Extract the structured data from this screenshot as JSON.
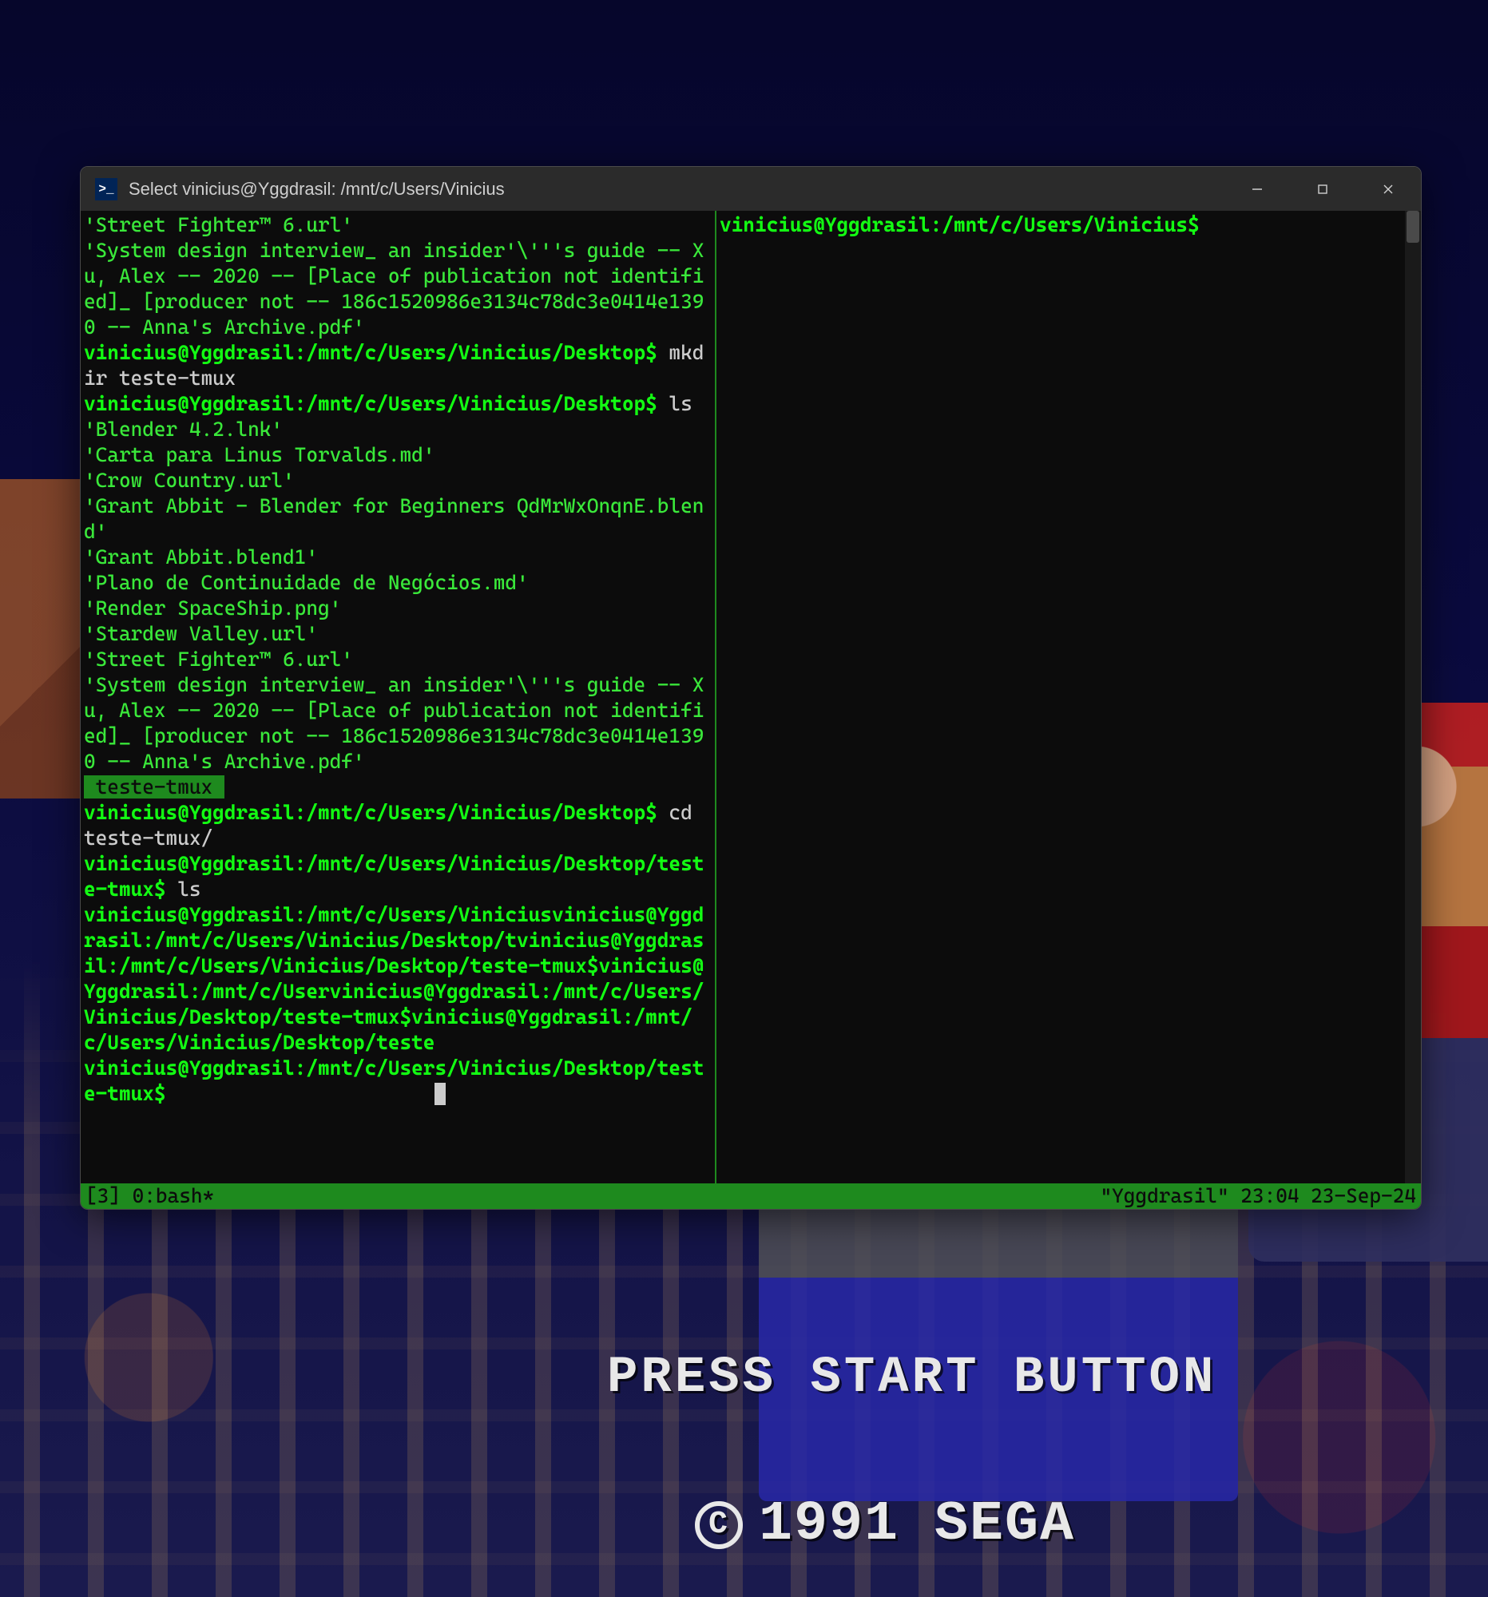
{
  "wallpaper": {
    "press_start": "PRESS START BUTTON",
    "copyright": "1991 SEGA"
  },
  "window": {
    "title": "Select vinicius@Yggdrasil: /mnt/c/Users/Vinicius",
    "controls": {
      "min": "minimize",
      "max": "maximize",
      "close": "close"
    }
  },
  "panes": {
    "right_prompt": "vinicius@Yggdrasil:/mnt/c/Users/Vinicius$"
  },
  "left_lines": [
    {
      "cls": "c",
      "text": "'Street Fighter™ 6.url'"
    },
    {
      "cls": "c",
      "text": "'System design interview_ an insider'\\'''s guide -- Xu, Alex -- 2020 -- [Place of publication not identified]_ [producer not -- 186c1520986e3134c78dc3e0414e1390 -- Anna's Archive.pdf'"
    },
    {
      "cls": "prompt",
      "prompt": "vinicius@Yggdrasil:/mnt/c/Users/Vinicius/Desktop$",
      "cmd": " mkdir teste-tmux"
    },
    {
      "cls": "prompt",
      "prompt": "vinicius@Yggdrasil:/mnt/c/Users/Vinicius/Desktop$",
      "cmd": " ls"
    },
    {
      "cls": "c",
      "text": "'Blender 4.2.lnk'"
    },
    {
      "cls": "c",
      "text": "'Carta para Linus Torvalds.md'"
    },
    {
      "cls": "c",
      "text": "'Crow Country.url'"
    },
    {
      "cls": "c",
      "text": "'Grant Abbit - Blender for Beginners QdMrWxOnqnE.blend'"
    },
    {
      "cls": "c",
      "text": "'Grant Abbit.blend1'"
    },
    {
      "cls": "c",
      "text": "'Plano de Continuidade de Negócios.md'"
    },
    {
      "cls": "c",
      "text": "'Render SpaceShip.png'"
    },
    {
      "cls": "c",
      "text": "'Stardew Valley.url'"
    },
    {
      "cls": "c",
      "text": "'Street Fighter™ 6.url'"
    },
    {
      "cls": "c",
      "text": "'System design interview_ an insider'\\'''s guide -- Xu, Alex -- 2020 -- [Place of publication not identified]_ [producer not -- 186c1520986e3134c78dc3e0414e1390 -- Anna's Archive.pdf'"
    },
    {
      "cls": "hl",
      "text": " teste-tmux "
    },
    {
      "cls": "prompt",
      "prompt": "vinicius@Yggdrasil:/mnt/c/Users/Vinicius/Desktop$",
      "cmd": " cd teste-tmux/"
    },
    {
      "cls": "prompt",
      "prompt": "vinicius@Yggdrasil:/mnt/c/Users/Vinicius/Desktop/teste-tmux$",
      "cmd": " ls"
    },
    {
      "cls": "g",
      "text": "vinicius@Yggdrasil:/mnt/c/Users/Viniciusvinicius@Yggdrasil:/mnt/c/Users/Vinicius/Desktop/tvinicius@Yggdrasil:/mnt/c/Users/Vinicius/Desktop/teste-tmux$vinicius@Yggdrasil:/mnt/c/Uservinicius@Yggdrasil:/mnt/c/Users/Vinicius/Desktop/teste-tmux$vinicius@Yggdrasil:/mnt/c/Users/Vinicius/Desktop/teste"
    },
    {
      "cls": "prompt",
      "prompt": "vinicius@Yggdrasil:/mnt/c/Users/Vinicius/Desktop/teste-tmux$",
      "cmd": "",
      "cursor": true
    }
  ],
  "status": {
    "left": "[3] 0:bash*",
    "right": "\"Yggdrasil\" 23:04 23-Sep-24"
  }
}
